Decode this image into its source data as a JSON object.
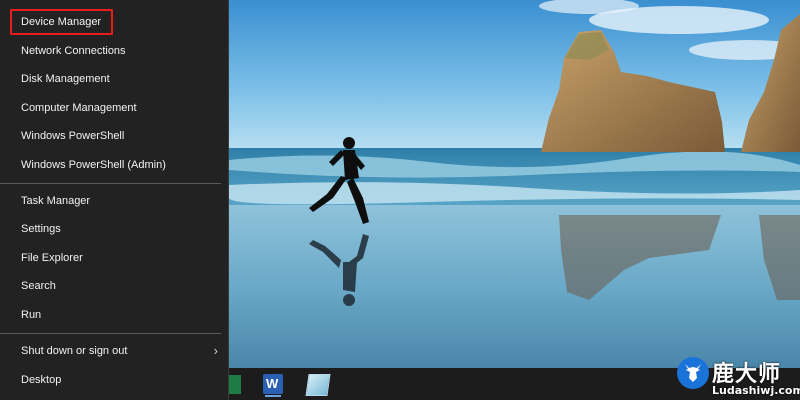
{
  "menu": {
    "items": [
      {
        "label": "Device Manager",
        "highlighted": true
      },
      {
        "label": "Network Connections"
      },
      {
        "label": "Disk Management"
      },
      {
        "label": "Computer Management"
      },
      {
        "label": "Windows PowerShell"
      },
      {
        "label": "Windows PowerShell (Admin)"
      },
      {
        "label": "Task Manager"
      },
      {
        "label": "Settings"
      },
      {
        "label": "File Explorer"
      },
      {
        "label": "Search"
      },
      {
        "label": "Run"
      },
      {
        "label": "Shut down or sign out",
        "has_submenu": true
      },
      {
        "label": "Desktop"
      }
    ],
    "highlight_color": "#e81e1e"
  },
  "taskbar": {
    "apps": [
      "excel-icon",
      "word-icon",
      "notepad-icon"
    ],
    "word_glyph": "W"
  },
  "watermark": {
    "brand": "鹿大师",
    "url": "Ludashiwj.com"
  }
}
